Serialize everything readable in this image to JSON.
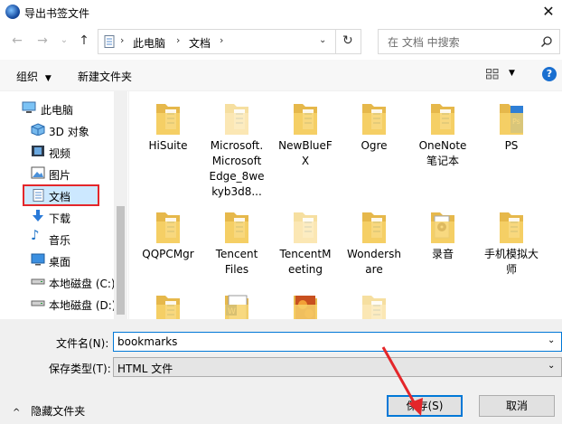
{
  "window": {
    "title": "导出书签文件",
    "close_glyph": "✕"
  },
  "address": {
    "crumbs": [
      "此电脑",
      "文档"
    ],
    "search_placeholder": "在 文档 中搜索"
  },
  "toolbar": {
    "organize": "组织",
    "new_folder": "新建文件夹"
  },
  "sidebar": {
    "items": [
      {
        "label": "此电脑",
        "icon": "computer-icon"
      },
      {
        "label": "3D 对象",
        "icon": "cube-3d-icon"
      },
      {
        "label": "视频",
        "icon": "video-icon"
      },
      {
        "label": "图片",
        "icon": "pictures-icon"
      },
      {
        "label": "文档",
        "icon": "documents-icon",
        "selected": true
      },
      {
        "label": "下载",
        "icon": "download-icon"
      },
      {
        "label": "音乐",
        "icon": "music-icon"
      },
      {
        "label": "桌面",
        "icon": "desktop-icon"
      },
      {
        "label": "本地磁盘 (C:)",
        "icon": "drive-icon"
      },
      {
        "label": "本地磁盘 (D:)",
        "icon": "drive-icon"
      }
    ]
  },
  "files": [
    {
      "name": "HiSuite",
      "type": "folder"
    },
    {
      "name": "Microsoft.\nMicrosoft\nEdge_8we\nkyb3d8...",
      "type": "folder-light"
    },
    {
      "name": "NewBlueF\nX",
      "type": "folder"
    },
    {
      "name": "Ogre",
      "type": "folder"
    },
    {
      "name": "OneNote\n笔记本",
      "type": "folder"
    },
    {
      "name": "PS",
      "type": "folder-blue"
    },
    {
      "name": "QQPCMgr",
      "type": "folder"
    },
    {
      "name": "Tencent\nFiles",
      "type": "folder"
    },
    {
      "name": "TencentM\neeting",
      "type": "folder-light"
    },
    {
      "name": "Wondersh\nare",
      "type": "folder"
    },
    {
      "name": "录音",
      "type": "folder-audio"
    },
    {
      "name": "手机模拟大\n师",
      "type": "folder"
    },
    {
      "name": "",
      "type": "folder"
    },
    {
      "name": "",
      "type": "folder-word"
    },
    {
      "name": "",
      "type": "folder-image"
    },
    {
      "name": "",
      "type": "folder-light"
    }
  ],
  "form": {
    "filename_label": "文件名(N):",
    "filename_value": "bookmarks",
    "filetype_label": "保存类型(T):",
    "filetype_value": "HTML 文件",
    "hide_folders": "隐藏文件夹",
    "save": "保存(S)",
    "cancel": "取消"
  }
}
